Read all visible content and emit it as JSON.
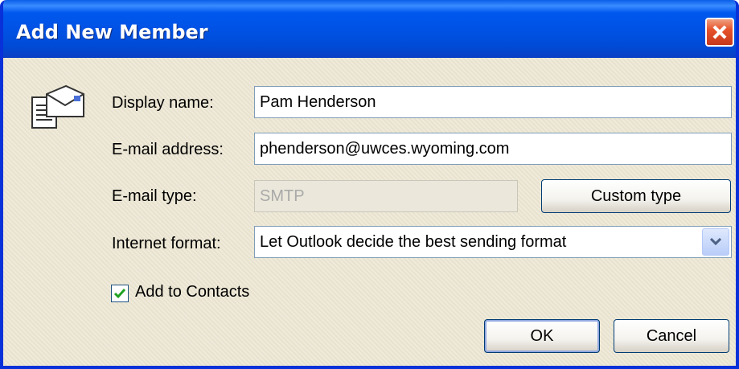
{
  "window": {
    "title": "Add New Member"
  },
  "icons": {
    "close": "close-icon",
    "contact": "envelope-contact-icon",
    "dropdown": "chevron-down-icon",
    "check": "checkmark-icon"
  },
  "form": {
    "display_name": {
      "label": "Display name:",
      "value": "Pam Henderson"
    },
    "email_address": {
      "label": "E-mail address:",
      "value": "phenderson@uwces.wyoming.com"
    },
    "email_type": {
      "label": "E-mail type:",
      "value": "SMTP",
      "button": "Custom type"
    },
    "internet_format": {
      "label": "Internet format:",
      "selected": "Let Outlook decide the best sending format"
    },
    "add_to_contacts": {
      "label": "Add to Contacts",
      "checked": true
    }
  },
  "buttons": {
    "ok": "OK",
    "cancel": "Cancel"
  },
  "colors": {
    "titlebar": "#0054e3",
    "close": "#e6532b",
    "dialog_bg": "#ece9d8",
    "input_border": "#7f9db9"
  }
}
